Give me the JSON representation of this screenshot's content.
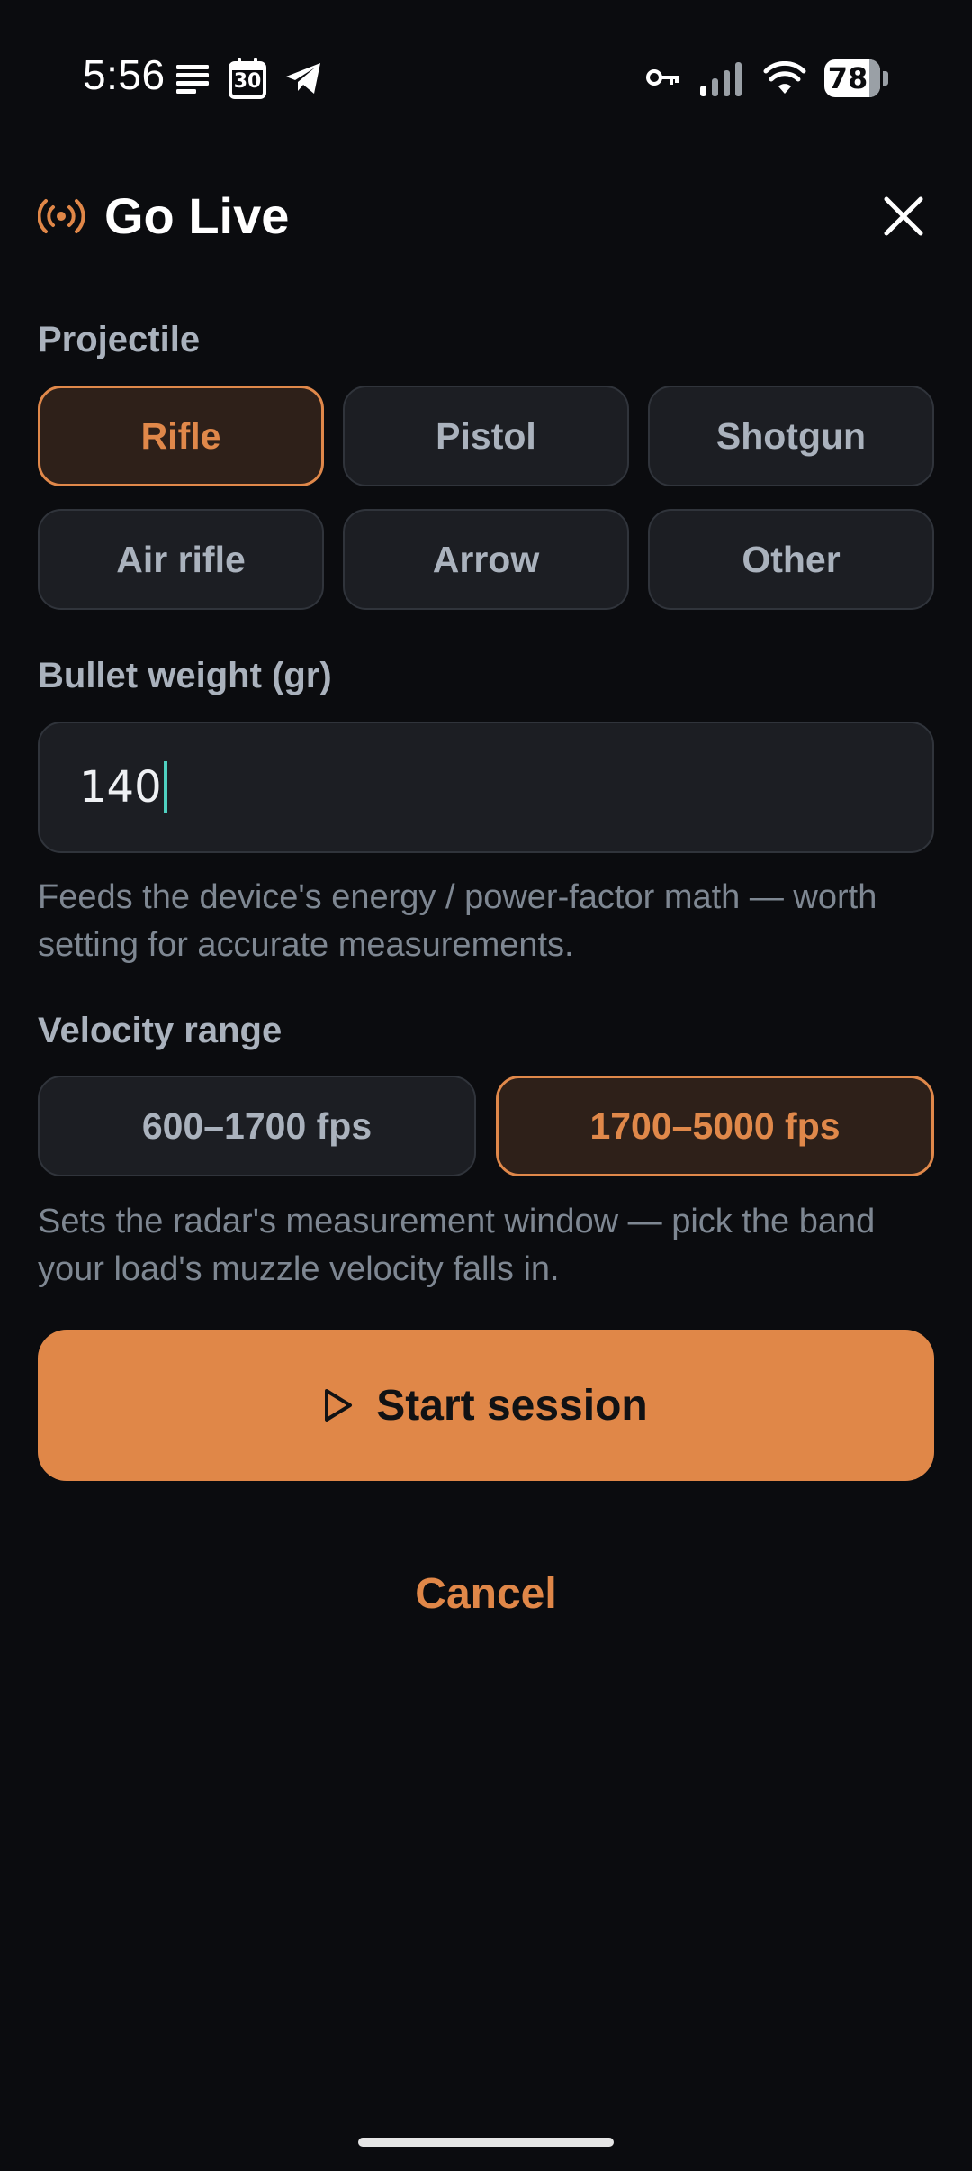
{
  "status_bar": {
    "time": "5:56",
    "calendar_day": "30",
    "battery_percent": "78",
    "battery_level": 0.78,
    "left_icons": [
      "notes-icon",
      "calendar-icon",
      "telegram-icon"
    ],
    "right_icons": [
      "vpn-key-icon",
      "signal-icon",
      "wifi-icon",
      "battery-icon"
    ]
  },
  "header": {
    "title": "Go Live",
    "icon": "live-broadcast-icon",
    "close_icon": "close-icon"
  },
  "projectile": {
    "label": "Projectile",
    "options": [
      "Rifle",
      "Pistol",
      "Shotgun",
      "Air rifle",
      "Arrow",
      "Other"
    ],
    "selected": "Rifle"
  },
  "bullet_weight": {
    "label": "Bullet weight (gr)",
    "value": "140",
    "helper": "Feeds the device's energy / power-factor math — worth setting for accurate measurements."
  },
  "velocity_range": {
    "label": "Velocity range",
    "options": [
      "600–1700 fps",
      "1700–5000 fps"
    ],
    "selected": "1700–5000 fps",
    "helper": "Sets the radar's measurement window — pick the band your load's muzzle velocity falls in."
  },
  "actions": {
    "start_label": "Start session",
    "start_icon": "play-icon",
    "cancel_label": "Cancel"
  },
  "colors": {
    "background": "#0b0c0f",
    "accent": "#e08748",
    "chip_bg": "#1c1e23",
    "chip_selected_bg": "#2e2019",
    "muted_text": "#7e8792",
    "label_text": "#aab2bd"
  }
}
